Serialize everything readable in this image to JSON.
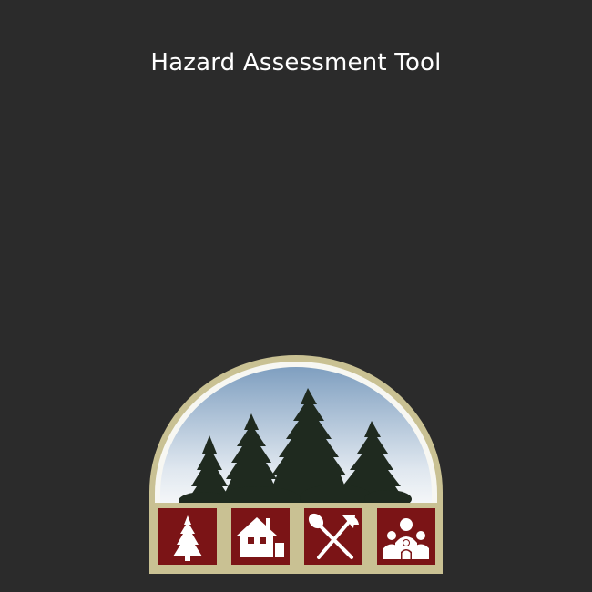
{
  "app": {
    "title": "Hazard Assessment Tool"
  },
  "logo": {
    "name": "forest-firewise-emblem",
    "icons": [
      "tree-icon",
      "house-icon",
      "shovel-axe-icon",
      "people-icon"
    ],
    "colors": {
      "background": "#2b2b2b",
      "frame": "#c9c193",
      "sky_top": "#7f9fc0",
      "sky_bottom": "#f0f3f6",
      "trees": "#1f2a1f",
      "tile": "#7b1416",
      "icon": "#ffffff"
    }
  }
}
